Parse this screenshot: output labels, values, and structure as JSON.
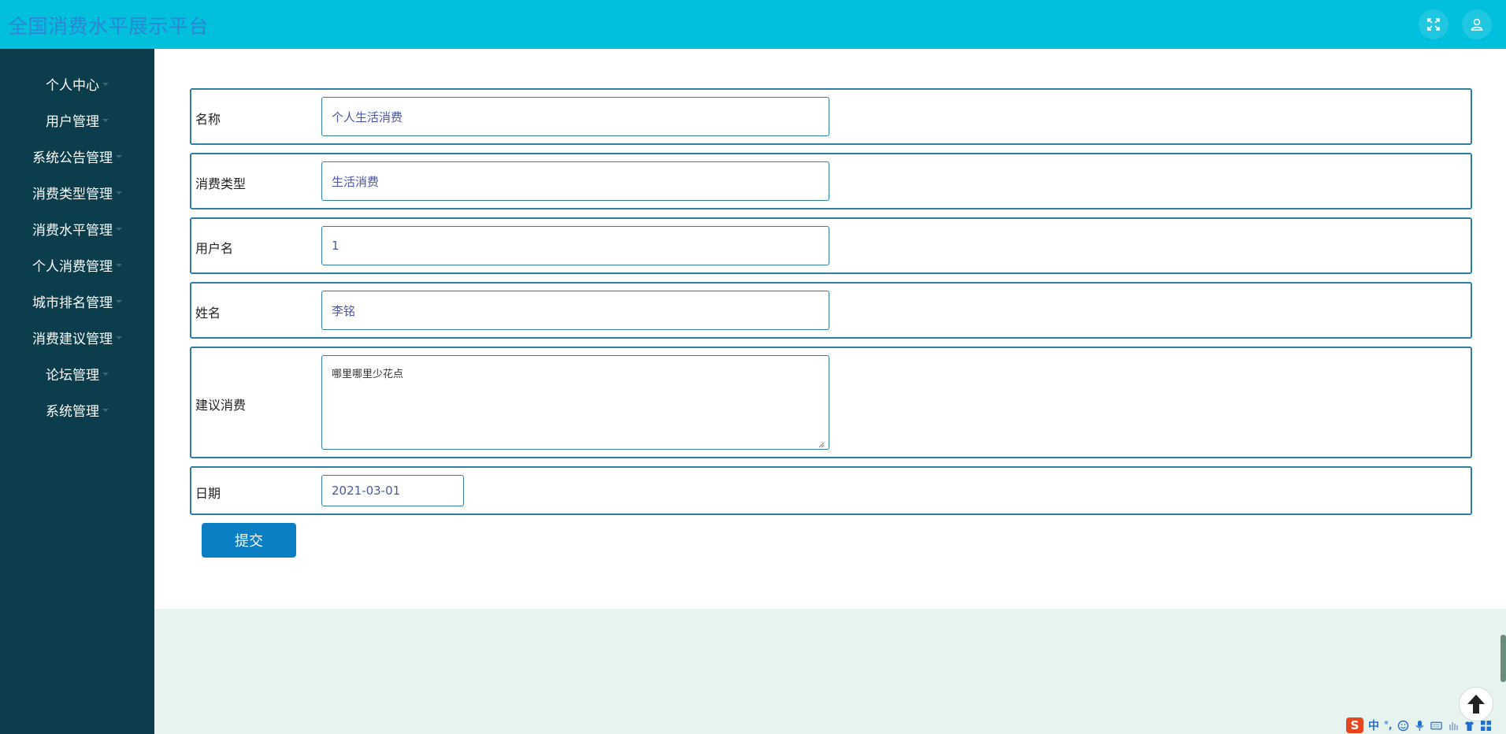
{
  "app": {
    "title": "全国消费水平展示平台"
  },
  "header": {
    "icons": [
      "fullscreen-icon",
      "user-icon"
    ]
  },
  "sidebar": {
    "items": [
      {
        "label": "个人中心"
      },
      {
        "label": "用户管理"
      },
      {
        "label": "系统公告管理"
      },
      {
        "label": "消费类型管理"
      },
      {
        "label": "消费水平管理"
      },
      {
        "label": "个人消费管理"
      },
      {
        "label": "城市排名管理"
      },
      {
        "label": "消费建议管理"
      },
      {
        "label": "论坛管理"
      },
      {
        "label": "系统管理"
      }
    ]
  },
  "form": {
    "name": {
      "label": "名称",
      "value": "个人生活消费"
    },
    "type": {
      "label": "消费类型",
      "value": "生活消费"
    },
    "username": {
      "label": "用户名",
      "value": "1"
    },
    "realname": {
      "label": "姓名",
      "value": "李铭"
    },
    "suggestion": {
      "label": "建议消费",
      "value": "哪里哪里少花点"
    },
    "date": {
      "label": "日期",
      "value": "2021-03-01"
    },
    "submit_label": "提交"
  },
  "ime": {
    "logo": "S",
    "mode": "中",
    "punct": "°,"
  },
  "colors": {
    "header": "#00c0dc",
    "sidebar": "#0b3d4d",
    "accent": "#0b7fc3",
    "border": "#2e7fa3"
  }
}
